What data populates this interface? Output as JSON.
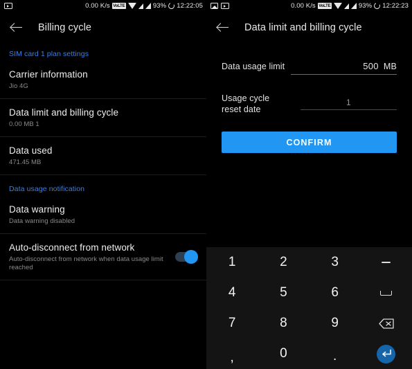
{
  "left_panel": {
    "status_bar": {
      "icons_left": [
        "video-icon"
      ],
      "network_speed": "0.00 K/s",
      "volte_label": "VoLTE",
      "battery_percent": "93%",
      "time": "12:22:05"
    },
    "appbar": {
      "back_icon": "back-arrow-icon",
      "title": "Billing cycle"
    },
    "sections": [
      {
        "header": "SIM card 1 plan settings"
      }
    ],
    "items": [
      {
        "title": "Carrier information",
        "subtitle": "Jio 4G"
      },
      {
        "title": "Data limit and billing cycle",
        "subtitle": "0.00 MB 1"
      },
      {
        "title": "Data used",
        "subtitle": "471.45 MB"
      }
    ],
    "notification_header": "Data usage notification",
    "notification_items": [
      {
        "title": "Data warning",
        "subtitle": "Data warning disabled"
      },
      {
        "title": "Auto-disconnect from network",
        "subtitle": "Auto-disconnect from network when data usage limit reached",
        "toggle_on": true
      }
    ]
  },
  "right_panel": {
    "status_bar": {
      "icons_left": [
        "photo-icon",
        "video-icon"
      ],
      "network_speed": "0.00 K/s",
      "volte_label": "VoLTE",
      "battery_percent": "93%",
      "time": "12:22:23"
    },
    "appbar": {
      "back_icon": "back-arrow-icon",
      "title": "Data limit and billing cycle"
    },
    "form": {
      "data_limit_label": "Data usage limit",
      "data_limit_value": "500",
      "data_limit_unit": "MB",
      "reset_date_label": "Usage cycle reset date",
      "reset_date_value": "1",
      "confirm_label": "CONFIRM"
    },
    "keypad": {
      "keys": [
        {
          "label": "1",
          "type": "digit"
        },
        {
          "label": "2",
          "type": "digit"
        },
        {
          "label": "3",
          "type": "digit"
        },
        {
          "label": "−",
          "type": "minus",
          "name": "minus-icon"
        },
        {
          "label": "4",
          "type": "digit"
        },
        {
          "label": "5",
          "type": "digit"
        },
        {
          "label": "6",
          "type": "digit"
        },
        {
          "label": "",
          "type": "space",
          "name": "space-icon"
        },
        {
          "label": "7",
          "type": "digit"
        },
        {
          "label": "8",
          "type": "digit"
        },
        {
          "label": "9",
          "type": "digit"
        },
        {
          "label": "",
          "type": "backspace",
          "name": "backspace-icon"
        },
        {
          "label": ",",
          "type": "comma"
        },
        {
          "label": "0",
          "type": "digit"
        },
        {
          "label": ".",
          "type": "dot"
        },
        {
          "label": "",
          "type": "enter",
          "name": "enter-icon"
        }
      ]
    }
  },
  "colors": {
    "accent": "#2196f3",
    "section_header": "#3f7fe0",
    "focused_underline": "#2979d8",
    "enter_key": "#1565a8",
    "background": "#000000",
    "keypad_background": "#141414"
  }
}
